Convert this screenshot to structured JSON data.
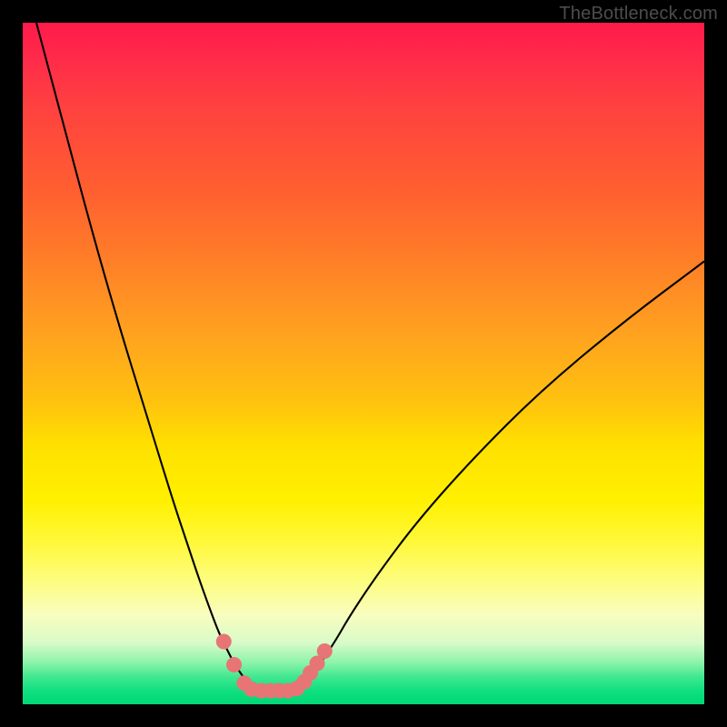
{
  "watermark": "TheBottleneck.com",
  "chart_data": {
    "type": "line",
    "title": "",
    "xlabel": "",
    "ylabel": "",
    "xlim": [
      0,
      100
    ],
    "ylim": [
      0,
      100
    ],
    "grid": false,
    "series": [
      {
        "name": "left-curve",
        "x": [
          2,
          6,
          10,
          14,
          18,
          22,
          24,
          26,
          28,
          29,
          30,
          31,
          32,
          33,
          34,
          35
        ],
        "y": [
          100,
          85,
          70,
          56,
          43,
          30,
          24,
          18,
          12.5,
          10,
          8,
          6,
          4.5,
          3.2,
          2.5,
          2.2
        ]
      },
      {
        "name": "right-curve",
        "x": [
          40,
          41,
          42,
          43,
          44,
          46,
          48,
          52,
          58,
          66,
          76,
          88,
          100
        ],
        "y": [
          2.2,
          2.8,
          3.8,
          5,
          6.5,
          9.5,
          13,
          19,
          27,
          36,
          46,
          56,
          65
        ]
      },
      {
        "name": "floor",
        "x": [
          35,
          36,
          37,
          38,
          39,
          40
        ],
        "y": [
          2.2,
          2.0,
          2.0,
          2.0,
          2.0,
          2.2
        ]
      }
    ],
    "markers": {
      "name": "dots",
      "color": "#e77576",
      "points": [
        {
          "x": 29.5,
          "y": 9.2
        },
        {
          "x": 31.0,
          "y": 5.8
        },
        {
          "x": 32.5,
          "y": 3.1
        },
        {
          "x": 33.6,
          "y": 2.2
        },
        {
          "x": 35.0,
          "y": 2.0
        },
        {
          "x": 36.3,
          "y": 2.0
        },
        {
          "x": 37.6,
          "y": 2.0
        },
        {
          "x": 38.9,
          "y": 2.0
        },
        {
          "x": 40.2,
          "y": 2.3
        },
        {
          "x": 41.3,
          "y": 3.3
        },
        {
          "x": 42.2,
          "y": 4.6
        },
        {
          "x": 43.2,
          "y": 6.0
        },
        {
          "x": 44.3,
          "y": 7.8
        }
      ]
    },
    "gradient_bands": [
      {
        "y_from": 100,
        "y_to": 15,
        "label": "red-yellow"
      },
      {
        "y_from": 15,
        "y_to": 3,
        "label": "yellow-pale"
      },
      {
        "y_from": 3,
        "y_to": 0,
        "label": "green"
      }
    ]
  }
}
